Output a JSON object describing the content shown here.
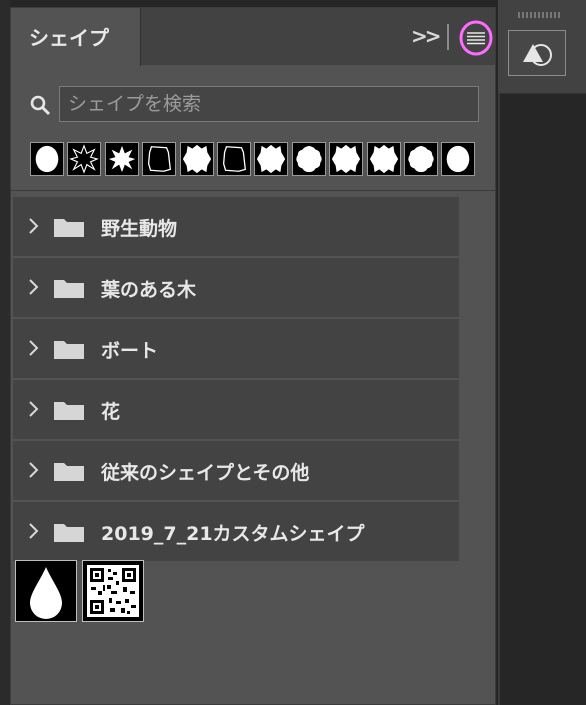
{
  "panel": {
    "tab_label": "シェイプ",
    "collapse_label": ">>"
  },
  "search": {
    "placeholder": "シェイプを検索"
  },
  "recent_shapes": [
    {
      "icon": "ellipse-shape-icon"
    },
    {
      "icon": "starburst-outline-shape-icon"
    },
    {
      "icon": "starburst-shape-icon"
    },
    {
      "icon": "frame-outline-shape-icon"
    },
    {
      "icon": "spiky-frame-shape-icon"
    },
    {
      "icon": "frame-outline-shape-icon"
    },
    {
      "icon": "spiky-frame-shape-icon"
    },
    {
      "icon": "scalloped-frame-shape-icon"
    },
    {
      "icon": "spiky-frame-shape-icon"
    },
    {
      "icon": "spiky-frame-shape-icon"
    },
    {
      "icon": "scalloped-frame-shape-icon"
    },
    {
      "icon": "ellipse-shape-icon"
    }
  ],
  "groups": [
    {
      "label": "野生動物"
    },
    {
      "label": "葉のある木"
    },
    {
      "label": "ボート"
    },
    {
      "label": "花"
    },
    {
      "label": "従来のシェイプとその他"
    },
    {
      "label": "2019_7_21カスタムシェイプ"
    }
  ],
  "loose_shapes": [
    {
      "icon": "raindrop-shape-icon"
    },
    {
      "icon": "qr-code-shape-icon"
    }
  ],
  "colors": {
    "panel_bg": "#535353",
    "row_bg": "#434343",
    "highlight": "#ff6bff"
  }
}
